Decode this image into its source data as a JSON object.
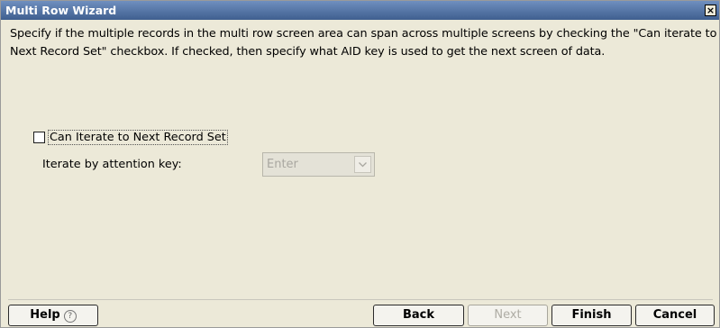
{
  "window": {
    "title": "Multi Row Wizard",
    "close_glyph": "×"
  },
  "instructions": "Specify if the multiple records in the multi row screen area can span across multiple screens by checking the \"Can iterate to Next Record Set\" checkbox. If checked, then specify what AID key is used to get the next screen of data.",
  "iterate_checkbox": {
    "label": "Can Iterate to Next Record Set",
    "checked": false
  },
  "attention_key": {
    "label": "Iterate by attention key:",
    "value": "Enter",
    "enabled": false
  },
  "buttons": {
    "help": "Help",
    "help_icon_glyph": "?",
    "back": "Back",
    "next": "Next",
    "finish": "Finish",
    "cancel": "Cancel"
  },
  "colors": {
    "title_bar": "#4f6f9f",
    "dialog_background": "#ece9d8",
    "disabled_text": "#aeaca4"
  },
  "icons": {
    "close": "close-icon",
    "dropdown": "chevron-down-icon",
    "help": "help-icon"
  }
}
